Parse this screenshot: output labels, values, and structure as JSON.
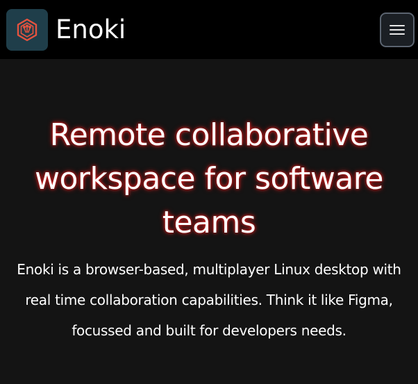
{
  "navbar": {
    "brand_name": "Enoki",
    "logo_icon": "enoki-logo-icon",
    "menu_icon": "hamburger-menu-icon"
  },
  "hero": {
    "title": "Remote collaborative workspace for software teams",
    "description": "Enoki is a browser-based, multiplayer Linux desktop with real time collaboration capabilities. Think it like Figma, focussed and built for developers needs."
  },
  "colors": {
    "navbar_background": "#000000",
    "page_background": "#141414",
    "logo_background": "#1f3e4a",
    "logo_accent": "#e5533f",
    "title_glow": "#e31b1b",
    "text": "#ffffff"
  }
}
